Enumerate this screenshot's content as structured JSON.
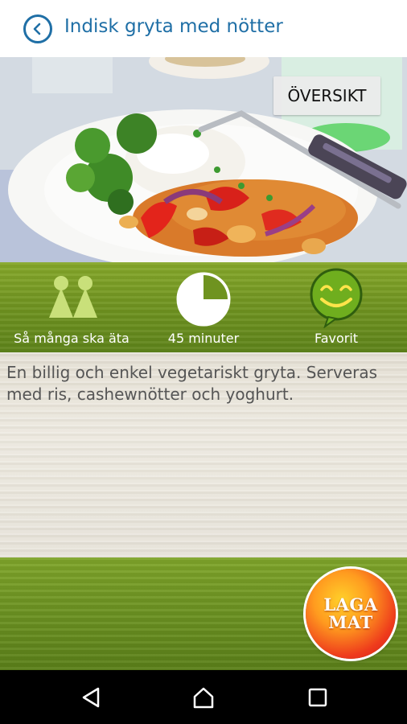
{
  "header": {
    "title": "Indisk gryta med nötter",
    "back_icon": "chevron-left-icon"
  },
  "photo": {
    "overview_label": "ÖVERSIKT"
  },
  "info": {
    "servings_label": "Så många ska äta",
    "time_label": "45 minuter",
    "time_fraction_shown": 0.75,
    "favorite_label": "Favorit"
  },
  "description": "En billig och enkel vegetariskt gryta. Serveras med ris, cashewnötter och yoghurt.",
  "cook_button": {
    "line1": "LAGA",
    "line2": "MAT"
  },
  "nav": {
    "back_icon": "triangle-back-icon",
    "home_icon": "home-icon",
    "recents_icon": "square-recents-icon"
  },
  "colors": {
    "accent": "#1f6fa6",
    "green": "#6f9320",
    "favorite_green": "#6fae1e"
  }
}
